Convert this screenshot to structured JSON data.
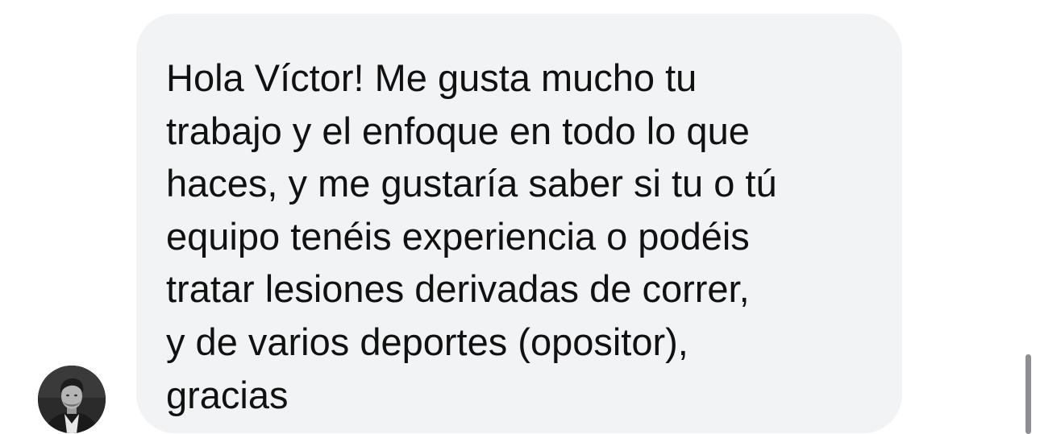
{
  "conversation": {
    "incoming_message": {
      "lines": [
        "Hola Víctor! Me gusta mucho tu",
        "trabajo y el enfoque en todo lo que",
        "haces, y me gustaría saber si tu o tú",
        "equipo tenéis experiencia o podéis",
        "tratar lesiones derivadas de correr,",
        "y de varios deportes (opositor),",
        "gracias"
      ],
      "bubble_color": "#f2f3f5",
      "text_color": "#111111"
    },
    "sender": {
      "avatar_icon": "profile-photo-icon"
    }
  },
  "scrollbar": {
    "color": "#8e8e93"
  }
}
